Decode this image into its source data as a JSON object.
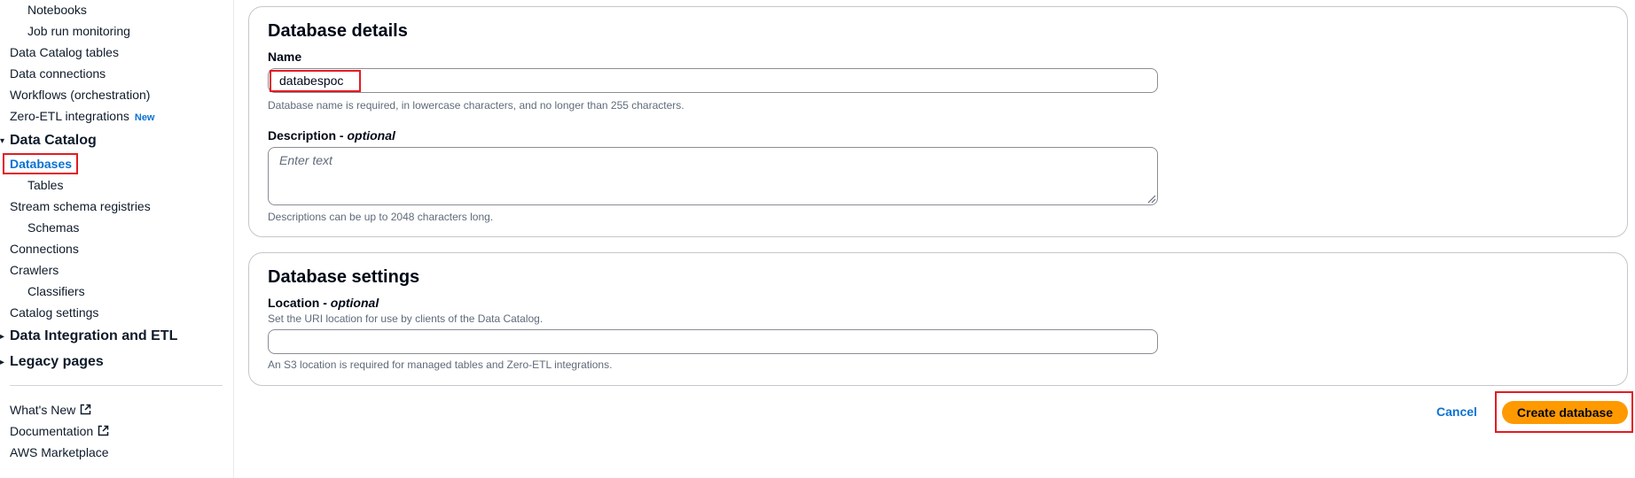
{
  "sidebar": {
    "items": [
      {
        "label": "Notebooks"
      },
      {
        "label": "Job run monitoring"
      },
      {
        "label": "Data Catalog tables"
      },
      {
        "label": "Data connections"
      },
      {
        "label": "Workflows (orchestration)"
      },
      {
        "label": "Zero-ETL integrations",
        "badge": "New"
      },
      {
        "label": "Data Catalog"
      },
      {
        "label": "Databases"
      },
      {
        "label": "Tables"
      },
      {
        "label": "Stream schema registries"
      },
      {
        "label": "Schemas"
      },
      {
        "label": "Connections"
      },
      {
        "label": "Crawlers"
      },
      {
        "label": "Classifiers"
      },
      {
        "label": "Catalog settings"
      },
      {
        "label": "Data Integration and ETL"
      },
      {
        "label": "Legacy pages"
      },
      {
        "label": "What's New"
      },
      {
        "label": "Documentation"
      },
      {
        "label": "AWS Marketplace"
      }
    ]
  },
  "database_details": {
    "title": "Database details",
    "name_label": "Name",
    "name_value": "databespoc",
    "name_hint": "Database name is required, in lowercase characters, and no longer than 255 characters.",
    "description_label": "Description - ",
    "description_optional": "optional",
    "description_placeholder": "Enter text",
    "description_hint": "Descriptions can be up to 2048 characters long."
  },
  "database_settings": {
    "title": "Database settings",
    "location_label": "Location - ",
    "location_optional": "optional",
    "location_desc": "Set the URI location for use by clients of the Data Catalog.",
    "location_value": "",
    "location_hint": "An S3 location is required for managed tables and Zero-ETL integrations."
  },
  "actions": {
    "cancel": "Cancel",
    "create": "Create database"
  },
  "colors": {
    "link": "#0972d3",
    "primary_button": "#ff9900",
    "highlight": "#e31b23"
  }
}
